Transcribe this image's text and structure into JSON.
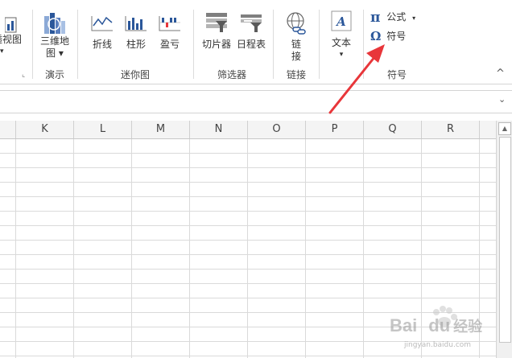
{
  "ribbon": {
    "partial_left": {
      "label1": "透视图",
      "label2": "▾"
    },
    "map3d": {
      "label1": "三维地",
      "label2": "图 ▾"
    },
    "demo_group": "演示",
    "sparkline": {
      "line": "折线",
      "column": "柱形",
      "winloss": "盈亏",
      "group": "迷你图"
    },
    "filters": {
      "slicer": "切片器",
      "timeline": "日程表",
      "group": "筛选器"
    },
    "links": {
      "link1": "链",
      "link2": "接",
      "group": "链接"
    },
    "text": {
      "label": "文本",
      "dropdown": "▾"
    },
    "symbols": {
      "equation": "公式",
      "equation_icon": "π",
      "symbol": "符号",
      "symbol_icon": "Ω",
      "group": "符号"
    },
    "collapse": "^"
  },
  "columns": [
    "K",
    "L",
    "M",
    "N",
    "O",
    "P",
    "Q",
    "R"
  ],
  "watermark": {
    "brand": "Bai",
    "brand2": "du",
    "jingyan": "经验",
    "url": "jingyan.baidu.com"
  },
  "colors": {
    "accent": "#217346",
    "arrow": "#e8363a",
    "icon_blue": "#2b579a"
  }
}
